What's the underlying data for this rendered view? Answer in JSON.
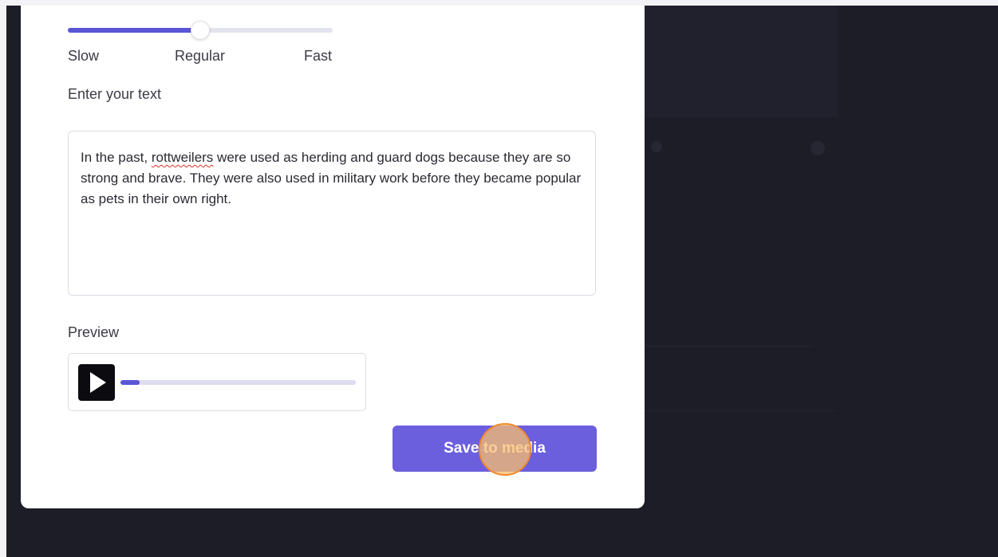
{
  "speed": {
    "labels": {
      "slow": "Slow",
      "regular": "Regular",
      "fast": "Fast"
    },
    "value_fraction": 0.5
  },
  "text_input": {
    "label": "Enter your text",
    "before": "In the past, ",
    "misspelled": "rottweilers",
    "after": " were used as herding and guard dogs because they are so strong and brave. They were also used in military work before they became popular as pets in their own right."
  },
  "preview": {
    "label": "Preview",
    "play_icon": "play-icon",
    "progress_fraction": 0.08
  },
  "actions": {
    "save_label": "Save to media"
  },
  "colors": {
    "accent": "#5b55d6",
    "button": "#6c5fde",
    "background": "#1c1d27",
    "click_marker": "#f08a2c"
  }
}
